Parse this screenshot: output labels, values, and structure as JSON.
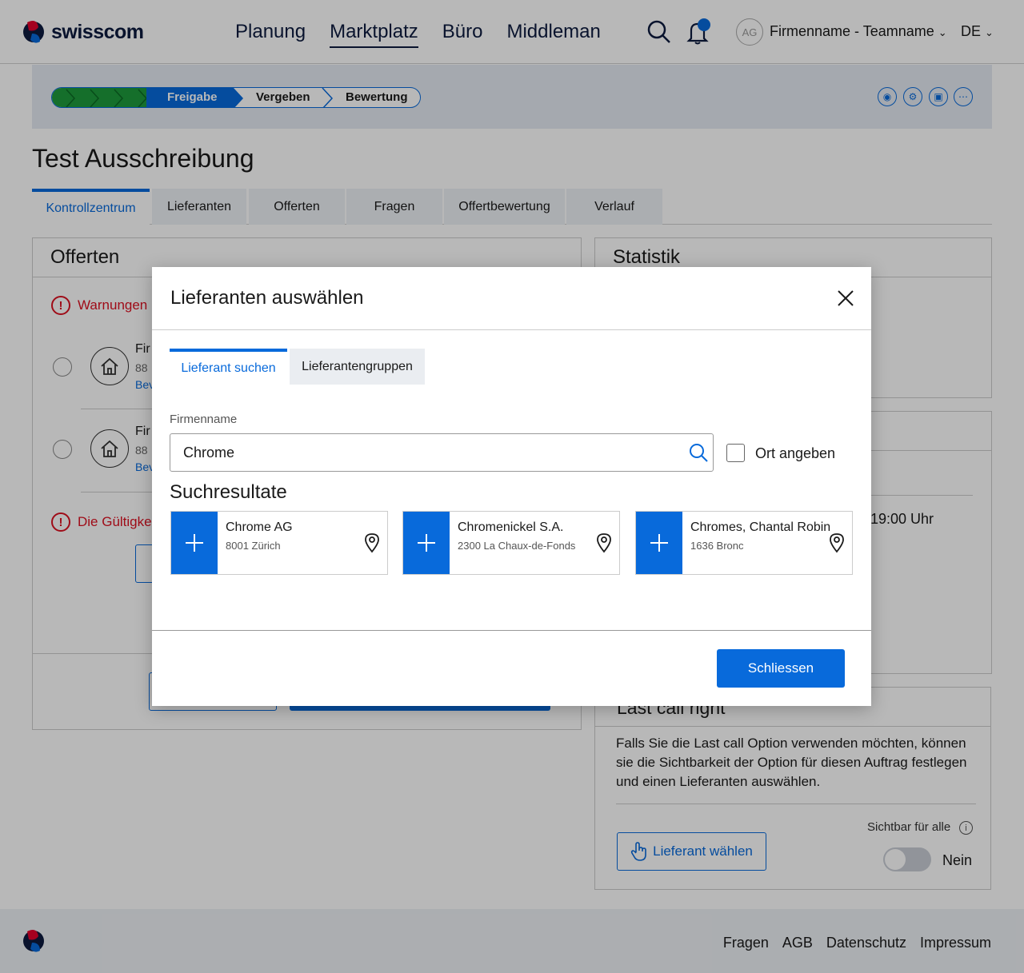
{
  "brand": {
    "name": "swisscom"
  },
  "nav": {
    "items": [
      "Planung",
      "Marktplatz",
      "Büro",
      "Middleman"
    ],
    "active": "Marktplatz"
  },
  "header": {
    "avatar_initials": "AG",
    "team": "Firmenname - Teamname",
    "lang": "DE"
  },
  "process": {
    "steps": [
      "Freigabe",
      "Vergeben",
      "Bewertung"
    ]
  },
  "page": {
    "title": "Test Ausschreibung"
  },
  "tabs": [
    "Kontrollzentrum",
    "Lieferanten",
    "Offerten",
    "Fragen",
    "Offertbewertung",
    "Verlauf"
  ],
  "offerten": {
    "title": "Offerten",
    "warning": "Warnungen",
    "rows": [
      {
        "name": "Fir",
        "code": "88",
        "link": "Bev"
      },
      {
        "name": "Fir",
        "code": "88",
        "link": "Bev"
      }
    ],
    "validity_warning": "Die Gültigke"
  },
  "statistik": {
    "title": "Statistik",
    "time_snip": "19:00 Uhr"
  },
  "last_call": {
    "title": "Last call right",
    "text": "Falls Sie die Last call Option verwenden möchten, können sie die Sichtbarkeit der Option für diesen Auftrag festlegen und einen Lieferanten auswählen.",
    "visible_label": "Sichtbar für alle",
    "button": "Lieferant wählen",
    "toggle_value": "Nein"
  },
  "footer": {
    "links": [
      "Fragen",
      "AGB",
      "Datenschutz",
      "Impressum"
    ]
  },
  "modal": {
    "title": "Lieferanten auswählen",
    "tabs": [
      "Lieferant suchen",
      "Lieferantengruppen"
    ],
    "field_label": "Firmenname",
    "search_value": "Chrome",
    "checkbox_label": "Ort angeben",
    "results_heading": "Suchresultate",
    "results": [
      {
        "name": "Chrome AG",
        "location": "8001 Zürich"
      },
      {
        "name": "Chromenickel S.A.",
        "location": "2300 La Chaux-de-Fonds"
      },
      {
        "name": "Chromes, Chantal Robin",
        "location": "1636 Bronc"
      }
    ],
    "close_button": "Schliessen"
  },
  "colors": {
    "primary": "#086adb",
    "brand_navy": "#0d1b3f",
    "success": "#1e9a3c",
    "error": "#dd1122"
  }
}
